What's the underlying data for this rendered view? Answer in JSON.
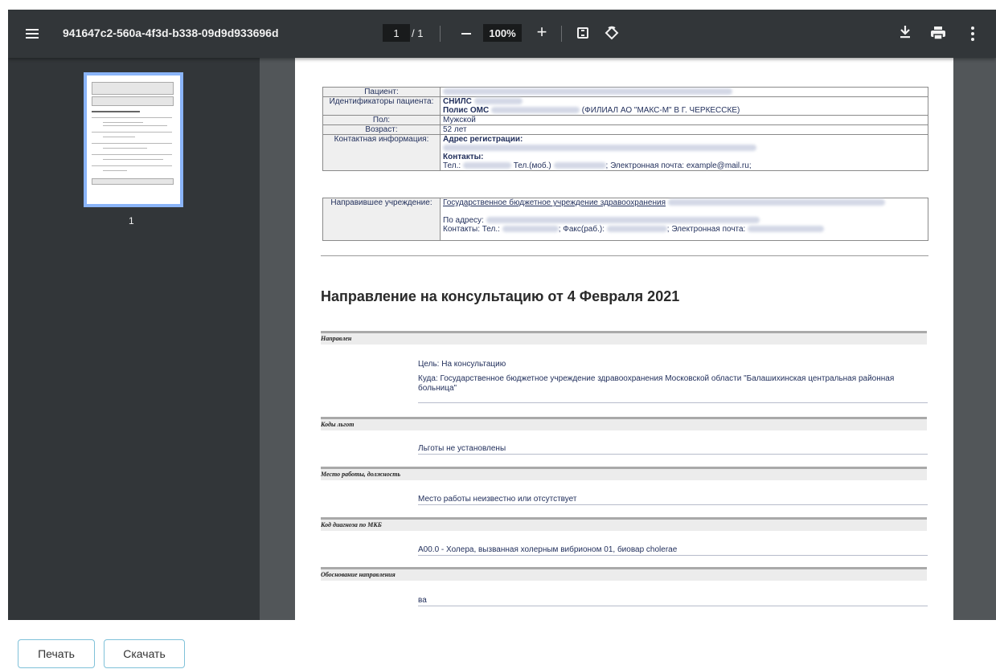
{
  "viewer": {
    "doc_title": "941647c2-560a-4f3d-b338-09d9d933696d",
    "page_current": "1",
    "page_total": "/ 1",
    "zoom": "100%",
    "zoom_in_label": "+",
    "thumbnail_page_number": "1"
  },
  "patient_table": {
    "rows": [
      {
        "label": "Пациент:",
        "value": ""
      },
      {
        "label": "Идентификаторы пациента:",
        "value_bold1": "СНИЛС",
        "value_bold2": "Полис ОМС",
        "value2_tail": "(ФИЛИАЛ АО \"МАКС-М\" В Г. ЧЕРКЕССКЕ)"
      },
      {
        "label": "Пол:",
        "value": "Мужской"
      },
      {
        "label": "Возраст:",
        "value": "52 лет"
      },
      {
        "label": "Контактная информация:",
        "value_bold1": "Адрес регистрации:",
        "value_bold2": "Контакты:",
        "phone_prefix": "Тел.:",
        "mobile": "Тел.(моб.)",
        "email": "; Электронная почта: example@mail.ru;"
      }
    ]
  },
  "referring_table": {
    "label": "Направившее учреждение:",
    "org": "Государственное бюджетное учреждение здравоохранения",
    "address_label": "По адресу:",
    "contacts_phone": "Контакты: Тел.:",
    "fax": "; Факс(раб.):",
    "email": "; Электронная почта:"
  },
  "document": {
    "heading": "Направление на консультацию от 4 Февраля 2021",
    "sections": [
      {
        "title": "Направлен",
        "lines": [
          "Цель: На консультацию",
          "Куда: Государственное бюджетное учреждение здравоохранения Московской области \"Балашихинская центральная районная больница\""
        ]
      },
      {
        "title": "Коды льгот",
        "lines": [
          "Льготы не установлены"
        ]
      },
      {
        "title": "Место работы, должность",
        "lines": [
          "Место работы неизвестно или отсутствует"
        ]
      },
      {
        "title": "Код диагноза по МКБ",
        "lines": [
          "A00.0 - Холера, вызванная холерным вибрионом 01, биовар cholerae"
        ]
      },
      {
        "title": "Обоснование направления",
        "lines": [
          "ва"
        ]
      }
    ]
  },
  "buttons": {
    "print": "Печать",
    "download": "Скачать"
  }
}
